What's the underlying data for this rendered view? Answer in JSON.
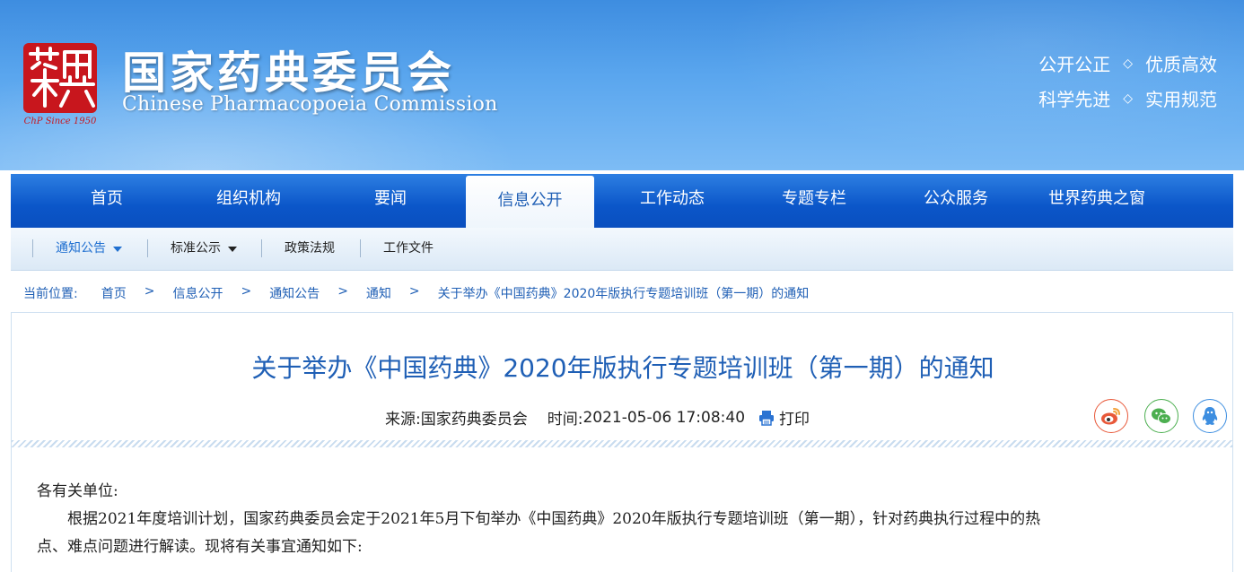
{
  "header": {
    "title_cn": "国家药典委员会",
    "title_en": "Chinese Pharmacopoeia Commission",
    "logo_glyphs": "藥典",
    "logo_tagline": "ChP Since 1950",
    "slogan": {
      "line1_a": "公开公正",
      "line1_b": "优质高效",
      "line2_a": "科学先进",
      "line2_b": "实用规范",
      "separator": "◇"
    },
    "colors": {
      "bg_top": "#3e8de0",
      "bg_bottom": "#7dbcf5",
      "seal_red": "#c8161d"
    }
  },
  "main_nav": {
    "items": [
      {
        "label": "首页"
      },
      {
        "label": "组织机构"
      },
      {
        "label": "要闻"
      },
      {
        "label": "信息公开",
        "active": true
      },
      {
        "label": "工作动态"
      },
      {
        "label": "专题专栏"
      },
      {
        "label": "公众服务"
      },
      {
        "label": "世界药典之窗"
      }
    ],
    "color": "#0b56c9"
  },
  "sub_nav": {
    "items": [
      {
        "label": "通知公告",
        "active": true,
        "dropdown": true
      },
      {
        "label": "标准公示",
        "dropdown": true
      },
      {
        "label": "政策法规"
      },
      {
        "label": "工作文件"
      }
    ]
  },
  "breadcrumb": {
    "label": "当前位置:",
    "items": [
      "首页",
      "信息公开",
      "通知公告",
      "通知",
      "关于举办《中国药典》2020年版执行专题培训班（第一期）的通知"
    ],
    "separator": ">"
  },
  "article": {
    "title": "关于举办《中国药典》2020年版执行专题培训班（第一期）的通知",
    "source_label": "来源:",
    "source": "国家药典委员会",
    "time_label": "时间:",
    "time": "2021-05-06 17:08:40",
    "print_label": "打印",
    "share_icons": [
      "weibo-icon",
      "wechat-icon",
      "qq-icon"
    ],
    "salutation": "各有关单位:",
    "paragraph1_line1": "根据2021年度培训计划，国家药典委员会定于2021年5月下旬举办《中国药典》2020年版执行专题培训班（第一期），针对药典执行过程中的热",
    "paragraph1_line2": "点、难点问题进行解读。现将有关事宜通知如下:"
  }
}
